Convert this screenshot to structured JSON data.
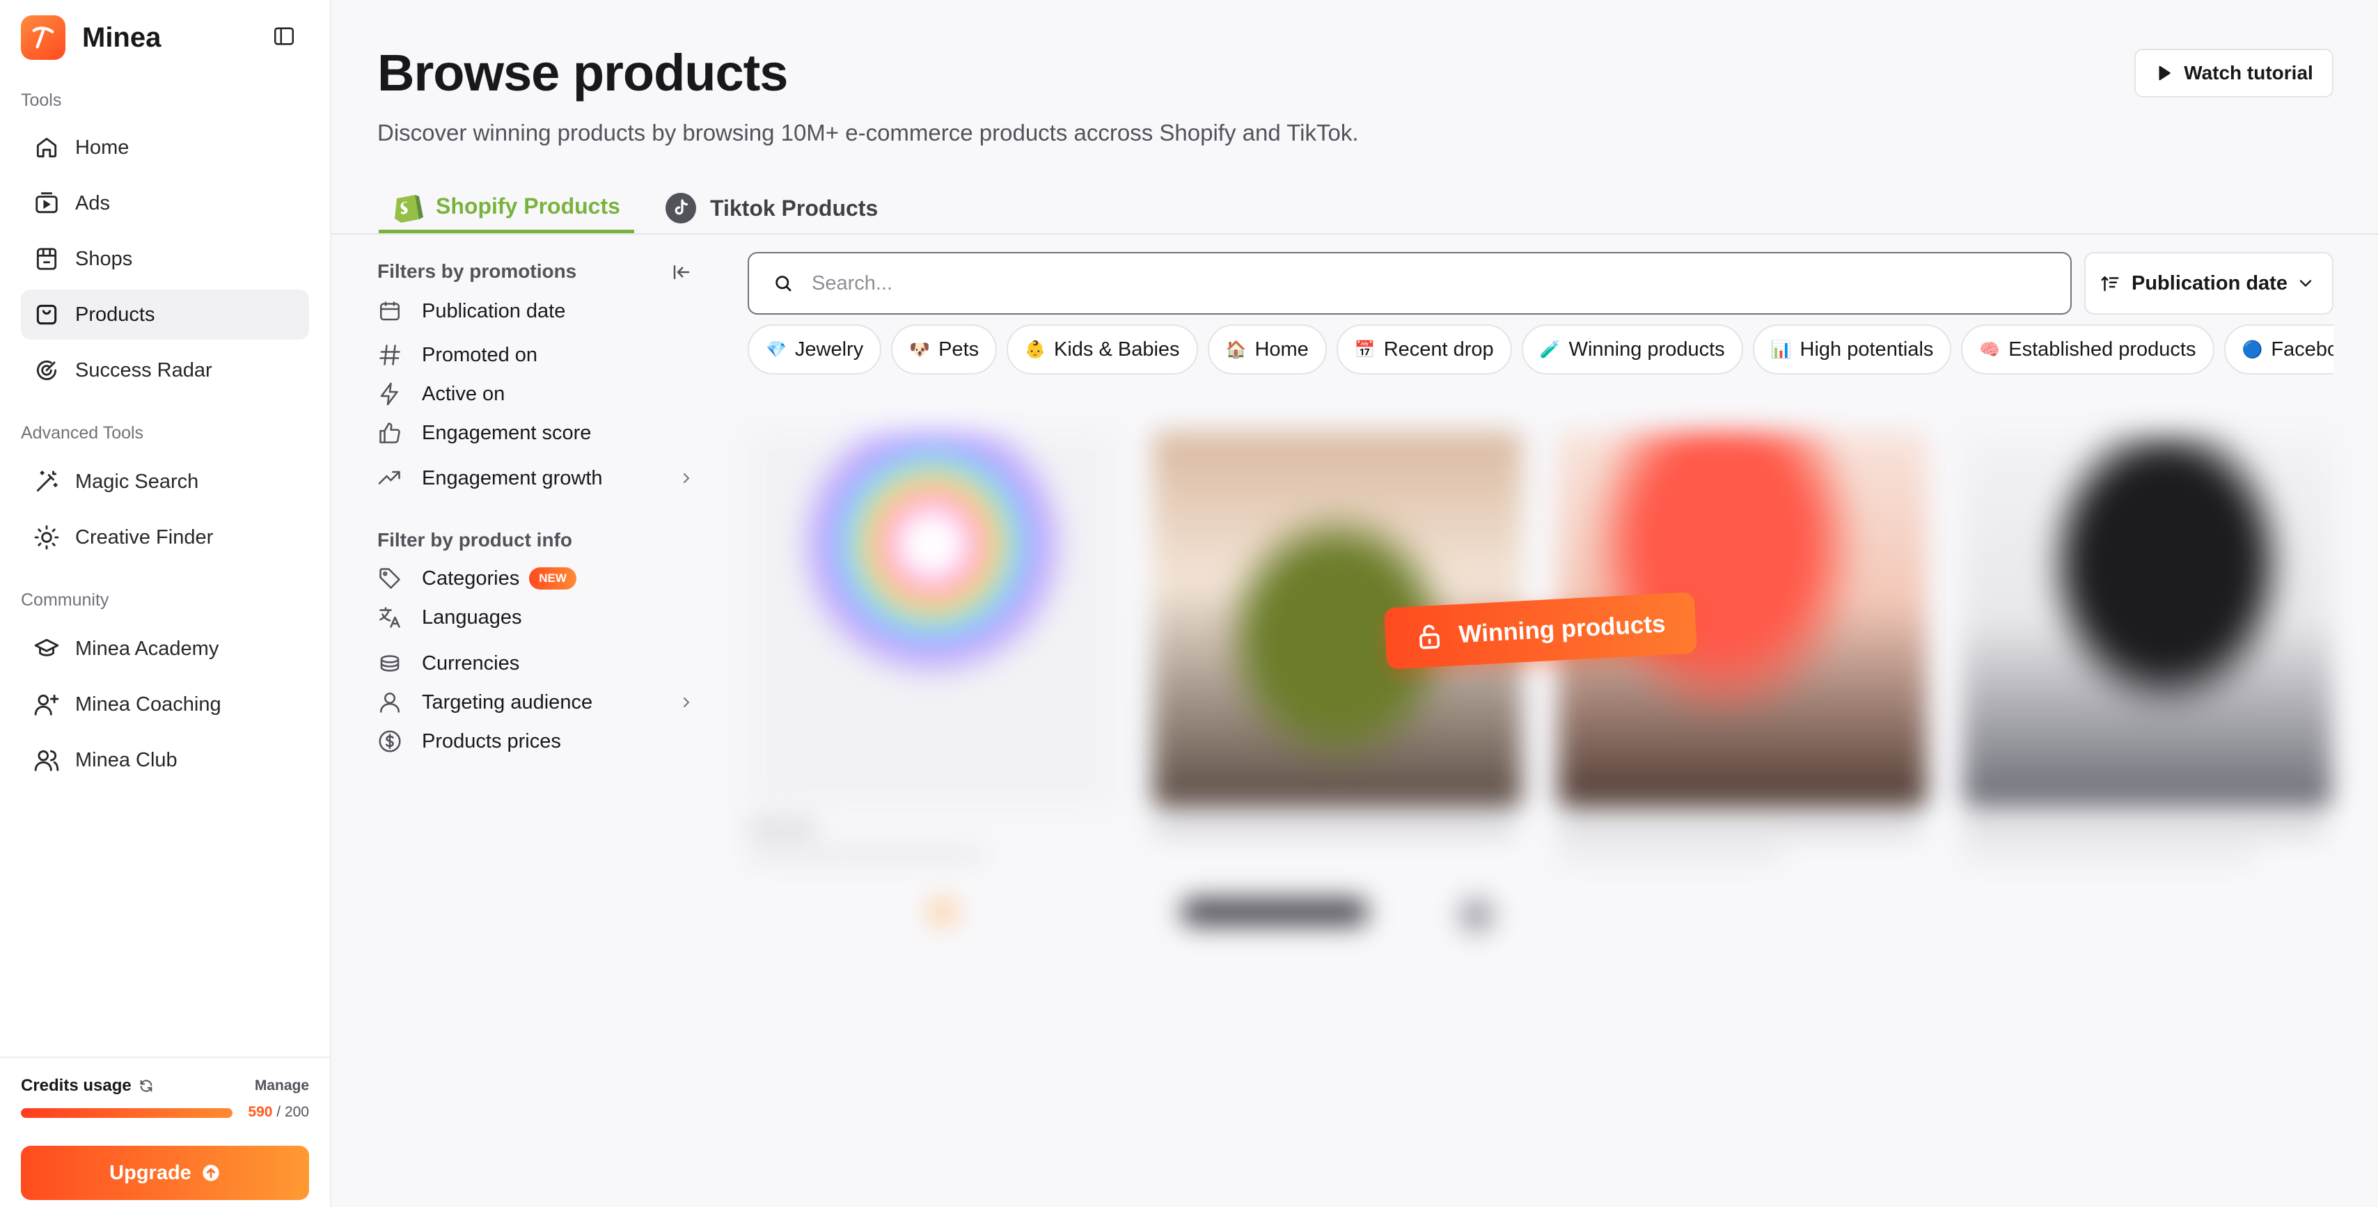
{
  "sidebar": {
    "brand": "Minea",
    "sections": {
      "tools": "Tools",
      "advanced": "Advanced Tools",
      "community": "Community"
    },
    "tools": [
      {
        "label": "Home",
        "icon": "home-icon"
      },
      {
        "label": "Ads",
        "icon": "ads-icon"
      },
      {
        "label": "Shops",
        "icon": "store-icon"
      },
      {
        "label": "Products",
        "icon": "product-icon",
        "active": true
      },
      {
        "label": "Success Radar",
        "icon": "radar-icon"
      }
    ],
    "advanced": [
      {
        "label": "Magic Search",
        "icon": "magic-wand-icon"
      },
      {
        "label": "Creative Finder",
        "icon": "sun-icon"
      }
    ],
    "community": [
      {
        "label": "Minea Academy",
        "icon": "graduation-cap-icon"
      },
      {
        "label": "Minea Coaching",
        "icon": "user-plus-icon"
      },
      {
        "label": "Minea Club",
        "icon": "users-icon"
      }
    ],
    "credits": {
      "title": "Credits usage",
      "manage": "Manage",
      "used": "590",
      "separator": " / ",
      "total": "200",
      "fill_fraction": 1.0
    },
    "upgrade_label": "Upgrade"
  },
  "header": {
    "title": "Browse products",
    "subtitle": "Discover winning products by browsing 10M+ e-commerce products accross Shopify and TikTok.",
    "tutorial_label": "Watch tutorial"
  },
  "tabs": [
    {
      "label": "Shopify Products",
      "icon": "shopify-bag-icon",
      "active": true
    },
    {
      "label": "Tiktok Products",
      "icon": "tiktok-icon",
      "active": false
    }
  ],
  "filters": {
    "promotions_title": "Filters by promotions",
    "promotions": [
      {
        "label": "Publication date",
        "icon": "calendar-icon"
      },
      {
        "label": "Promoted on",
        "icon": "hash-icon"
      },
      {
        "label": "Active on",
        "icon": "bolt-icon"
      },
      {
        "label": "Engagement score",
        "icon": "thumbs-up-icon"
      },
      {
        "label": "Engagement growth",
        "icon": "trend-up-icon",
        "expandable": true
      }
    ],
    "product_info_title": "Filter by product info",
    "product_info": [
      {
        "label": "Categories",
        "icon": "tag-icon",
        "badge": "NEW"
      },
      {
        "label": "Languages",
        "icon": "translate-icon"
      },
      {
        "label": "Currencies",
        "icon": "coins-icon"
      },
      {
        "label": "Targeting audience",
        "icon": "person-icon",
        "expandable": true
      },
      {
        "label": "Products prices",
        "icon": "dollar-circle-icon"
      }
    ]
  },
  "search": {
    "placeholder": "Search...",
    "value": ""
  },
  "sort": {
    "label": "Publication date"
  },
  "chips": [
    {
      "emoji": "💎",
      "label": "Jewelry"
    },
    {
      "emoji": "🐶",
      "label": "Pets"
    },
    {
      "emoji": "👶",
      "label": "Kids & Babies"
    },
    {
      "emoji": "🏠",
      "label": "Home"
    },
    {
      "emoji": "📅",
      "label": "Recent drop"
    },
    {
      "emoji": "🧪",
      "label": "Winning products"
    },
    {
      "emoji": "📊",
      "label": "High potentials"
    },
    {
      "emoji": "🧠",
      "label": "Established products"
    },
    {
      "emoji": "🔵",
      "label": "Facebook"
    }
  ],
  "locked_overlay": {
    "label": "Winning products",
    "icon": "unlock-icon"
  },
  "colors": {
    "accent_orange": "#ff5a1f",
    "shopify_green": "#7ab33b"
  }
}
